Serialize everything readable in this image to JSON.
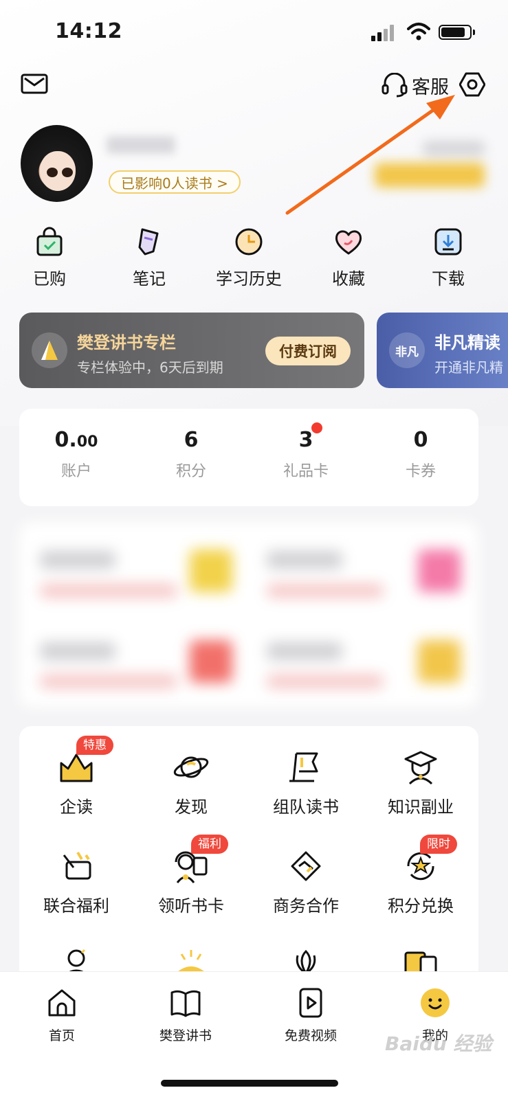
{
  "status_bar": {
    "time": "14:12"
  },
  "header": {
    "service_label": "客服"
  },
  "profile": {
    "influence_text": "已影响0人读书 >"
  },
  "quick_actions": [
    {
      "label": "已购",
      "icon": "shopping-bag-icon"
    },
    {
      "label": "笔记",
      "icon": "note-pen-icon"
    },
    {
      "label": "学习历史",
      "icon": "clock-icon"
    },
    {
      "label": "收藏",
      "icon": "heart-icon"
    },
    {
      "label": "下载",
      "icon": "download-icon"
    }
  ],
  "promo_cards": [
    {
      "icon_text": "",
      "title": "樊登讲书专栏",
      "subtitle": "专栏体验中，6天后到期",
      "button": "付费订阅"
    },
    {
      "icon_text": "非凡",
      "title": "非凡精读",
      "subtitle": "开通非凡精"
    }
  ],
  "stats": [
    {
      "value_main": "0.",
      "value_small": "00",
      "label": "账户"
    },
    {
      "value_main": "6",
      "value_small": "",
      "label": "积分"
    },
    {
      "value_main": "3",
      "value_small": "",
      "label": "礼品卡",
      "has_dot": true
    },
    {
      "value_main": "0",
      "value_small": "",
      "label": "卡券"
    }
  ],
  "services": [
    {
      "label": "企读",
      "badge": "特惠",
      "icon": "enterprise-reading-icon"
    },
    {
      "label": "发现",
      "badge": "",
      "icon": "planet-icon"
    },
    {
      "label": "组队读书",
      "badge": "",
      "icon": "flag-icon"
    },
    {
      "label": "知识副业",
      "badge": "",
      "icon": "graduation-cap-icon"
    },
    {
      "label": "联合福利",
      "badge": "",
      "icon": "gift-card-icon"
    },
    {
      "label": "领听书卡",
      "badge": "福利",
      "icon": "listen-card-icon"
    },
    {
      "label": "商务合作",
      "badge": "",
      "icon": "handshake-icon"
    },
    {
      "label": "积分兑换",
      "badge": "限时",
      "icon": "star-exchange-icon"
    }
  ],
  "tabs": [
    {
      "label": "首页",
      "icon": "home-icon"
    },
    {
      "label": "樊登讲书",
      "icon": "book-icon"
    },
    {
      "label": "免费视频",
      "icon": "video-play-icon"
    },
    {
      "label": "我的",
      "icon": "smiley-face-icon",
      "active": true
    }
  ],
  "watermark": "Baidu 经验",
  "colors": {
    "accent": "#f5c842",
    "badge": "#f0483c",
    "arrow": "#f26a1b",
    "promo_gold": "#f6d59a"
  }
}
